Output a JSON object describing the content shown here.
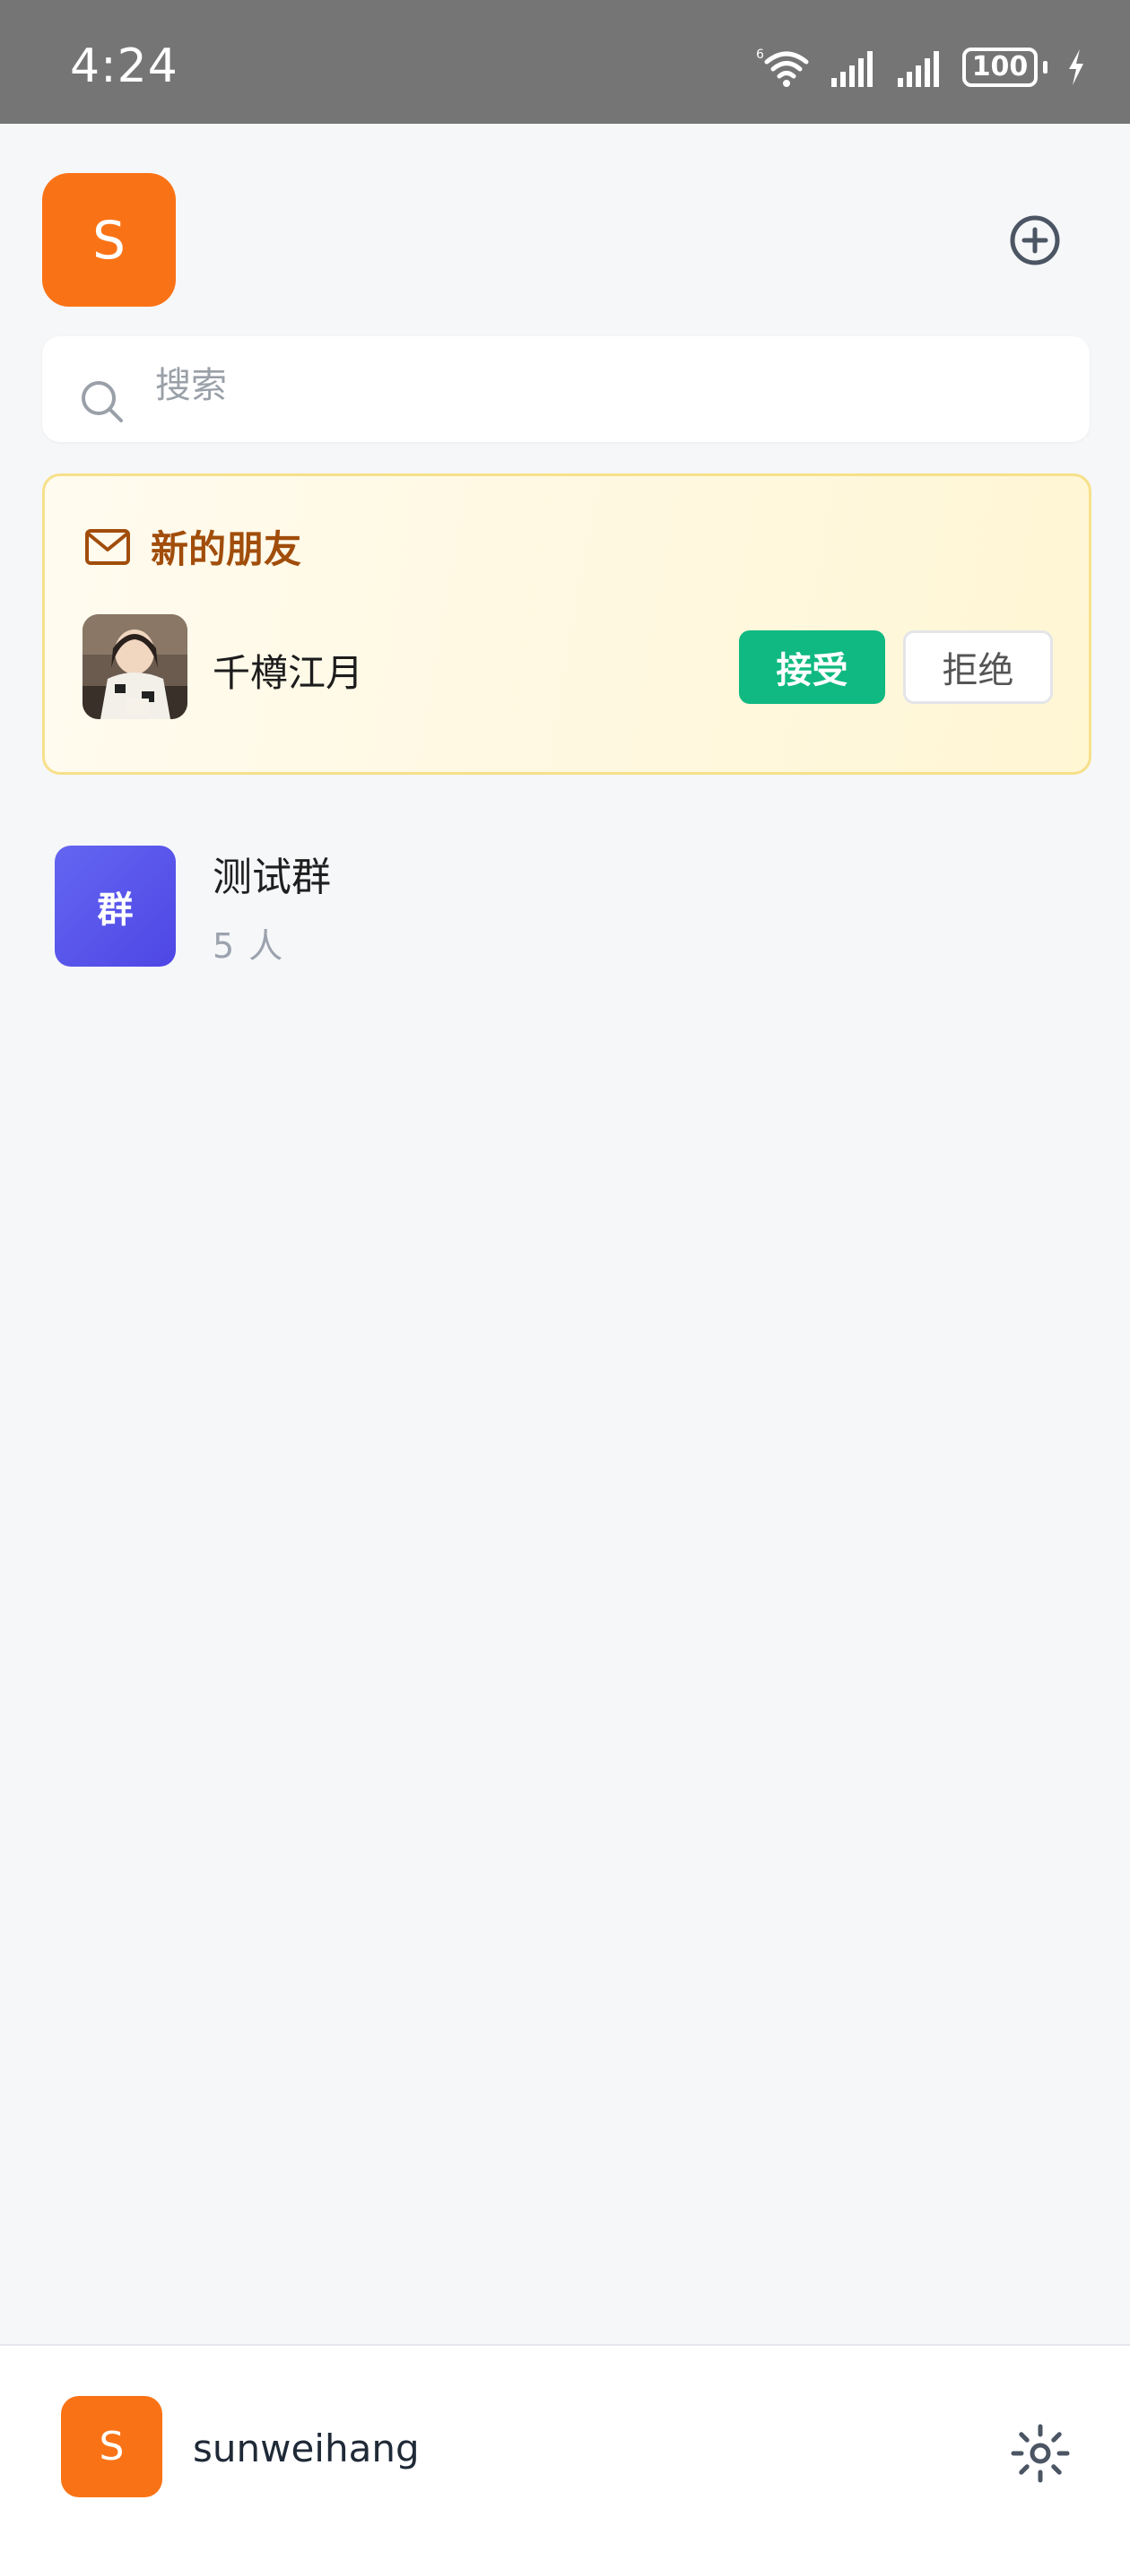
{
  "status_bar": {
    "time": "4:24",
    "battery": "100"
  },
  "profile": {
    "avatar_letter": "S",
    "avatar_color": "#f97316"
  },
  "search": {
    "placeholder": "搜索",
    "value": ""
  },
  "new_friends": {
    "title": "新的朋友",
    "requests": [
      {
        "name": "千樽江月",
        "accept_label": "接受",
        "reject_label": "拒绝"
      }
    ]
  },
  "groups": [
    {
      "avatar_label": "群",
      "name": "测试群",
      "count": "5 人"
    }
  ],
  "bottom_bar": {
    "avatar_letter": "S",
    "username": "sunweihang"
  },
  "icons": [
    "mail-icon",
    "search-icon",
    "add-circle-icon",
    "settings-icon",
    "wifi-icon",
    "signal-icon",
    "battery-icon",
    "charging-icon"
  ],
  "colors": {
    "accent_orange": "#f97316",
    "accept_green": "#10b981",
    "group_purple": "#4f46e5",
    "card_title": "#a14d0b"
  }
}
